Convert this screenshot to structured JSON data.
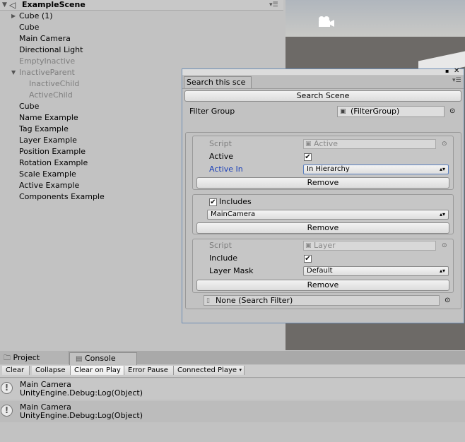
{
  "hierarchy": {
    "scene_name": "ExampleScene",
    "items": [
      {
        "label": "Cube (1)",
        "depth": 1,
        "expandable": true,
        "inactive": false
      },
      {
        "label": "Cube",
        "depth": 1,
        "expandable": false,
        "inactive": false
      },
      {
        "label": "Main Camera",
        "depth": 1,
        "expandable": false,
        "inactive": false
      },
      {
        "label": "Directional Light",
        "depth": 1,
        "expandable": false,
        "inactive": false
      },
      {
        "label": "EmptyInactive",
        "depth": 1,
        "expandable": false,
        "inactive": true
      },
      {
        "label": "InactiveParent",
        "depth": 1,
        "expandable": true,
        "inactive": true
      },
      {
        "label": "InactiveChild",
        "depth": 2,
        "expandable": false,
        "inactive": true
      },
      {
        "label": "ActiveChild",
        "depth": 2,
        "expandable": false,
        "inactive": true
      },
      {
        "label": "Cube",
        "depth": 1,
        "expandable": false,
        "inactive": false
      },
      {
        "label": "Name Example",
        "depth": 1,
        "expandable": false,
        "inactive": false
      },
      {
        "label": "Tag Example",
        "depth": 1,
        "expandable": false,
        "inactive": false
      },
      {
        "label": "Layer Example",
        "depth": 1,
        "expandable": false,
        "inactive": false
      },
      {
        "label": "Position Example",
        "depth": 1,
        "expandable": false,
        "inactive": false
      },
      {
        "label": "Rotation Example",
        "depth": 1,
        "expandable": false,
        "inactive": false
      },
      {
        "label": "Scale Example",
        "depth": 1,
        "expandable": false,
        "inactive": false
      },
      {
        "label": "Active Example",
        "depth": 1,
        "expandable": false,
        "inactive": false
      },
      {
        "label": "Components Example",
        "depth": 1,
        "expandable": false,
        "inactive": false
      }
    ]
  },
  "search_window": {
    "tab_title": "Search this sce",
    "search_button": "Search Scene",
    "filter_group_label": "Filter Group",
    "filter_group_value": "(FilterGroup)",
    "filter1": {
      "script_label": "Script",
      "script_value": "Active",
      "active_label": "Active",
      "active_checked": true,
      "active_in_label": "Active In",
      "active_in_value": "In Hierarchy",
      "remove_label": "Remove"
    },
    "filter2": {
      "includes_label": "Includes",
      "includes_checked": true,
      "camera_value": "MainCamera",
      "remove_label": "Remove"
    },
    "filter3": {
      "script_label": "Script",
      "script_value": "Layer",
      "include_label": "Include",
      "include_checked": true,
      "layer_mask_label": "Layer Mask",
      "layer_mask_value": "Default",
      "remove_label": "Remove"
    },
    "none_field": "None (Search Filter)"
  },
  "console": {
    "tabs": [
      "Project",
      "Console"
    ],
    "active_tab": "Console",
    "toolbar": [
      "Clear",
      "Collapse",
      "Clear on Play",
      "Error Pause",
      "Connected Playe"
    ],
    "logs": [
      {
        "line1": "Main Camera",
        "line2": "UnityEngine.Debug:Log(Object)"
      },
      {
        "line1": "Main Camera",
        "line2": "UnityEngine.Debug:Log(Object)"
      }
    ]
  },
  "colors": {
    "window_border": "#6f8fb6",
    "active_in_label": "#1a3fb8",
    "inactive_text": "#7e7e7e"
  }
}
